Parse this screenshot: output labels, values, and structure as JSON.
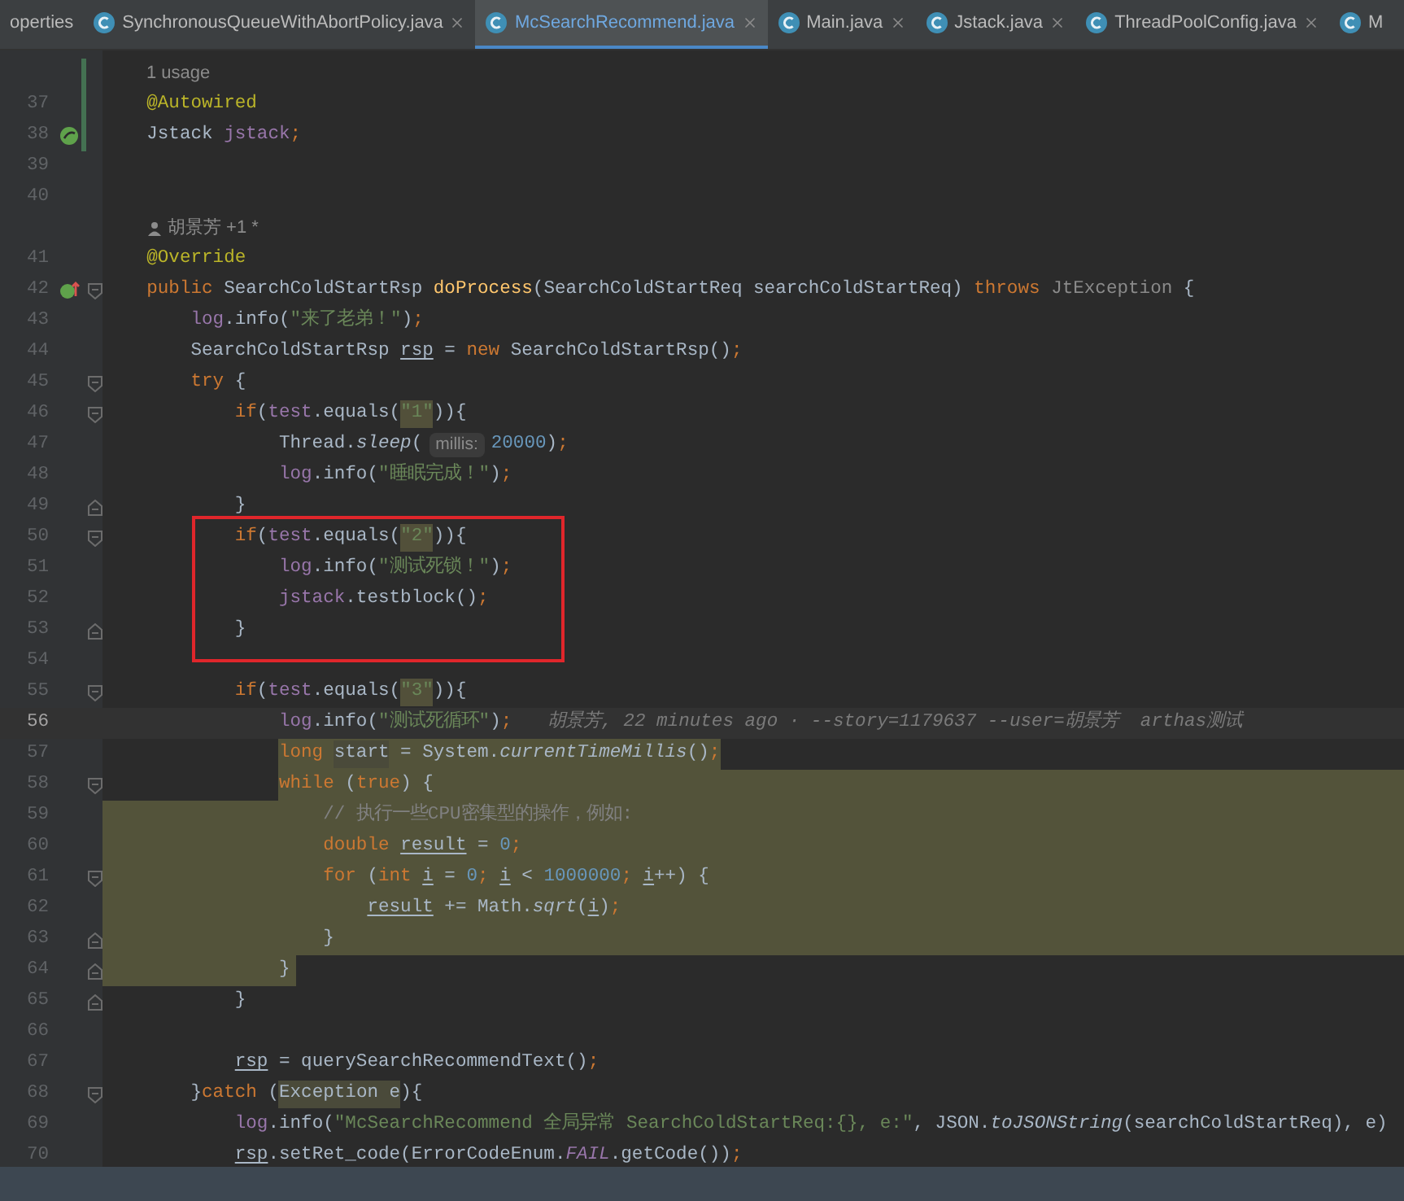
{
  "tabs": [
    {
      "label": "operties",
      "selected": false,
      "icon": false,
      "closable": false
    },
    {
      "label": "SynchronousQueueWithAbortPolicy.java",
      "selected": false,
      "icon": true,
      "closable": true
    },
    {
      "label": "McSearchRecommend.java",
      "selected": true,
      "icon": true,
      "closable": true
    },
    {
      "label": "Main.java",
      "selected": false,
      "icon": true,
      "closable": true
    },
    {
      "label": "Jstack.java",
      "selected": false,
      "icon": true,
      "closable": true
    },
    {
      "label": "ThreadPoolConfig.java",
      "selected": false,
      "icon": true,
      "closable": true
    },
    {
      "label": "M",
      "selected": false,
      "icon": true,
      "closable": false
    }
  ],
  "editor": {
    "lines": [
      {
        "kind": "meta",
        "text": "1 usage",
        "changed": true
      },
      {
        "kind": "code",
        "number": "37",
        "changed": true,
        "tokens": [
          {
            "text": "    @Autowired",
            "kind": "annotation"
          }
        ]
      },
      {
        "kind": "code",
        "number": "38",
        "changed": true,
        "bean_marker": true,
        "tokens": [
          {
            "text": "    Jstack ",
            "kind": "plain"
          },
          {
            "text": "jstack",
            "kind": "field"
          },
          {
            "text": ";",
            "kind": "keyword"
          }
        ]
      },
      {
        "kind": "code",
        "number": "39"
      },
      {
        "kind": "code",
        "number": "40"
      },
      {
        "kind": "author",
        "text": "胡景芳 +1 *"
      },
      {
        "kind": "code",
        "number": "41",
        "tokens": [
          {
            "text": "    @Override",
            "kind": "annotation"
          }
        ]
      },
      {
        "kind": "code",
        "number": "42",
        "override_marker": true,
        "fold_start": true,
        "tokens": [
          {
            "text": "    public ",
            "kind": "keyword"
          },
          {
            "text": "SearchColdStartRsp ",
            "kind": "plain"
          },
          {
            "text": "doProcess",
            "kind": "method"
          },
          {
            "text": "(SearchColdStartReq searchColdStartReq) ",
            "kind": "plain"
          },
          {
            "text": "throws ",
            "kind": "keyword"
          },
          {
            "text": "JtException",
            "kind": "muted"
          },
          {
            "text": " {",
            "kind": "plain"
          }
        ]
      },
      {
        "kind": "code",
        "number": "43",
        "tokens": [
          {
            "text": "        log",
            "kind": "field"
          },
          {
            "text": ".info(",
            "kind": "plain"
          },
          {
            "text": "\"来了老弟！\"",
            "kind": "string"
          },
          {
            "text": ")",
            "kind": "plain"
          },
          {
            "text": ";",
            "kind": "keyword"
          }
        ]
      },
      {
        "kind": "code",
        "number": "44",
        "tokens": [
          {
            "text": "        SearchColdStartRsp ",
            "kind": "plain"
          },
          {
            "text": "rsp",
            "kind": "reassigned"
          },
          {
            "text": " = ",
            "kind": "plain"
          },
          {
            "text": "new ",
            "kind": "keyword"
          },
          {
            "text": "SearchColdStartRsp()",
            "kind": "plain"
          },
          {
            "text": ";",
            "kind": "keyword"
          }
        ]
      },
      {
        "kind": "code",
        "number": "45",
        "fold_start": true,
        "tokens": [
          {
            "text": "        try ",
            "kind": "keyword"
          },
          {
            "text": "{",
            "kind": "plain"
          }
        ]
      },
      {
        "kind": "code",
        "number": "46",
        "fold_start": true,
        "tokens": [
          {
            "text": "            if",
            "kind": "keyword"
          },
          {
            "text": "(",
            "kind": "plain"
          },
          {
            "text": "test",
            "kind": "field"
          },
          {
            "text": ".equals(",
            "kind": "plain"
          },
          {
            "text": "\"1\"",
            "kind": "string_marked"
          },
          {
            "text": ")){",
            "kind": "plain"
          }
        ]
      },
      {
        "kind": "code",
        "number": "47",
        "tokens": [
          {
            "text": "                Thread.",
            "kind": "plain"
          },
          {
            "text": "sleep",
            "kind": "static"
          },
          {
            "text": "(",
            "kind": "plain"
          },
          {
            "text": "millis:",
            "kind": "hint"
          },
          {
            "text": "20000",
            "kind": "number"
          },
          {
            "text": ")",
            "kind": "plain"
          },
          {
            "text": ";",
            "kind": "keyword"
          }
        ]
      },
      {
        "kind": "code",
        "number": "48",
        "tokens": [
          {
            "text": "                log",
            "kind": "field"
          },
          {
            "text": ".info(",
            "kind": "plain"
          },
          {
            "text": "\"睡眠完成！\"",
            "kind": "string"
          },
          {
            "text": ")",
            "kind": "plain"
          },
          {
            "text": ";",
            "kind": "keyword"
          }
        ]
      },
      {
        "kind": "code",
        "number": "49",
        "fold_end": true,
        "tokens": [
          {
            "text": "            }",
            "kind": "plain"
          }
        ]
      },
      {
        "kind": "code",
        "number": "50",
        "fold_start": true,
        "boxed": true,
        "tokens": [
          {
            "text": "            if",
            "kind": "keyword"
          },
          {
            "text": "(",
            "kind": "plain"
          },
          {
            "text": "test",
            "kind": "field"
          },
          {
            "text": ".equals(",
            "kind": "plain"
          },
          {
            "text": "\"2\"",
            "kind": "string_marked"
          },
          {
            "text": ")){",
            "kind": "plain"
          }
        ]
      },
      {
        "kind": "code",
        "number": "51",
        "boxed": true,
        "tokens": [
          {
            "text": "                log",
            "kind": "field"
          },
          {
            "text": ".info(",
            "kind": "plain"
          },
          {
            "text": "\"测试死锁！\"",
            "kind": "string"
          },
          {
            "text": ")",
            "kind": "plain"
          },
          {
            "text": ";",
            "kind": "keyword"
          }
        ]
      },
      {
        "kind": "code",
        "number": "52",
        "boxed": true,
        "tokens": [
          {
            "text": "                jstack",
            "kind": "field"
          },
          {
            "text": ".testblock()",
            "kind": "plain"
          },
          {
            "text": ";",
            "kind": "keyword"
          }
        ]
      },
      {
        "kind": "code",
        "number": "53",
        "fold_end": true,
        "boxed": true,
        "tokens": [
          {
            "text": "            }",
            "kind": "plain"
          }
        ]
      },
      {
        "kind": "code",
        "number": "54"
      },
      {
        "kind": "code",
        "number": "55",
        "fold_start": true,
        "tokens": [
          {
            "text": "            if",
            "kind": "keyword"
          },
          {
            "text": "(",
            "kind": "plain"
          },
          {
            "text": "test",
            "kind": "field"
          },
          {
            "text": ".equals(",
            "kind": "plain"
          },
          {
            "text": "\"3\"",
            "kind": "string_marked"
          },
          {
            "text": ")){",
            "kind": "plain"
          }
        ]
      },
      {
        "kind": "code",
        "number": "56",
        "current": true,
        "blame": "胡景芳, 22 minutes ago · --story=1179637 --user=胡景芳  arthas测试",
        "tokens": [
          {
            "text": "                log",
            "kind": "field"
          },
          {
            "text": ".info(",
            "kind": "plain"
          },
          {
            "text": "\"测试死循环\"",
            "kind": "string"
          },
          {
            "text": ")",
            "kind": "plain"
          },
          {
            "text": ";",
            "kind": "keyword"
          }
        ]
      },
      {
        "kind": "code",
        "number": "57",
        "highlight": {
          "kind": "text"
        },
        "tokens": [
          {
            "text": "                long ",
            "kind": "keyword"
          },
          {
            "text": "start",
            "kind": "plain_marked"
          },
          {
            "text": " = System.",
            "kind": "plain"
          },
          {
            "text": "currentTimeMillis",
            "kind": "static"
          },
          {
            "text": "()",
            "kind": "plain"
          },
          {
            "text": ";",
            "kind": "keyword"
          }
        ]
      },
      {
        "kind": "code",
        "number": "58",
        "fold_start": true,
        "highlight": {
          "kind": "rest"
        },
        "tokens": [
          {
            "text": "                while ",
            "kind": "keyword"
          },
          {
            "text": "(",
            "kind": "plain"
          },
          {
            "text": "true",
            "kind": "keyword"
          },
          {
            "text": ") {",
            "kind": "plain"
          }
        ]
      },
      {
        "kind": "code",
        "number": "59",
        "highlight": {
          "kind": "full"
        },
        "tokens": [
          {
            "text": "                    // 执行一些CPU密集型的操作，例如:",
            "kind": "comment"
          }
        ]
      },
      {
        "kind": "code",
        "number": "60",
        "highlight": {
          "kind": "full"
        },
        "tokens": [
          {
            "text": "                    double ",
            "kind": "keyword"
          },
          {
            "text": "result",
            "kind": "reassigned"
          },
          {
            "text": " = ",
            "kind": "plain"
          },
          {
            "text": "0",
            "kind": "number"
          },
          {
            "text": ";",
            "kind": "keyword"
          }
        ]
      },
      {
        "kind": "code",
        "number": "61",
        "fold_start": true,
        "highlight": {
          "kind": "full"
        },
        "tokens": [
          {
            "text": "                    for ",
            "kind": "keyword"
          },
          {
            "text": "(",
            "kind": "plain"
          },
          {
            "text": "int ",
            "kind": "keyword"
          },
          {
            "text": "i",
            "kind": "reassigned"
          },
          {
            "text": " = ",
            "kind": "plain"
          },
          {
            "text": "0",
            "kind": "number"
          },
          {
            "text": "; ",
            "kind": "keyword"
          },
          {
            "text": "i",
            "kind": "reassigned"
          },
          {
            "text": " < ",
            "kind": "plain"
          },
          {
            "text": "1000000",
            "kind": "number"
          },
          {
            "text": "; ",
            "kind": "keyword"
          },
          {
            "text": "i",
            "kind": "reassigned"
          },
          {
            "text": "++) {",
            "kind": "plain"
          }
        ]
      },
      {
        "kind": "code",
        "number": "62",
        "highlight": {
          "kind": "full"
        },
        "tokens": [
          {
            "text": "                        result",
            "kind": "reassigned"
          },
          {
            "text": " += Math.",
            "kind": "plain"
          },
          {
            "text": "sqrt",
            "kind": "static"
          },
          {
            "text": "(",
            "kind": "plain"
          },
          {
            "text": "i",
            "kind": "reassigned"
          },
          {
            "text": ")",
            "kind": "plain"
          },
          {
            "text": ";",
            "kind": "keyword"
          }
        ]
      },
      {
        "kind": "code",
        "number": "63",
        "fold_end": true,
        "highlight": {
          "kind": "full"
        },
        "tokens": [
          {
            "text": "                    }",
            "kind": "plain"
          }
        ]
      },
      {
        "kind": "code",
        "number": "64",
        "fold_end": true,
        "highlight": {
          "kind": "block"
        },
        "tokens": [
          {
            "text": "                }",
            "kind": "plain"
          }
        ]
      },
      {
        "kind": "code",
        "number": "65",
        "fold_end": true,
        "tokens": [
          {
            "text": "            }",
            "kind": "plain"
          }
        ]
      },
      {
        "kind": "code",
        "number": "66"
      },
      {
        "kind": "code",
        "number": "67",
        "tokens": [
          {
            "text": "            rsp",
            "kind": "reassigned"
          },
          {
            "text": " = querySearchRecommendText()",
            "kind": "plain"
          },
          {
            "text": ";",
            "kind": "keyword"
          }
        ]
      },
      {
        "kind": "code",
        "number": "68",
        "fold_start": true,
        "tokens": [
          {
            "text": "        }",
            "kind": "plain"
          },
          {
            "text": "catch ",
            "kind": "keyword"
          },
          {
            "text": "(",
            "kind": "plain"
          },
          {
            "text": "Exception e",
            "kind": "plain_marked"
          },
          {
            "text": "){",
            "kind": "plain"
          }
        ]
      },
      {
        "kind": "code",
        "number": "69",
        "tokens": [
          {
            "text": "            log",
            "kind": "field"
          },
          {
            "text": ".info(",
            "kind": "plain"
          },
          {
            "text": "\"McSearchRecommend 全局异常 SearchColdStartReq:{}, e:\"",
            "kind": "string"
          },
          {
            "text": ", JSON.",
            "kind": "plain"
          },
          {
            "text": "toJSONString",
            "kind": "static"
          },
          {
            "text": "(searchColdStartReq), e)",
            "kind": "plain"
          }
        ]
      },
      {
        "kind": "code",
        "number": "70",
        "tokens": [
          {
            "text": "            rsp",
            "kind": "reassigned"
          },
          {
            "text": ".setRet_code(ErrorCodeEnum.",
            "kind": "plain"
          },
          {
            "text": "FAIL",
            "kind": "static_field"
          },
          {
            "text": ".getCode())",
            "kind": "plain"
          },
          {
            "text": ";",
            "kind": "keyword"
          }
        ]
      }
    ]
  }
}
